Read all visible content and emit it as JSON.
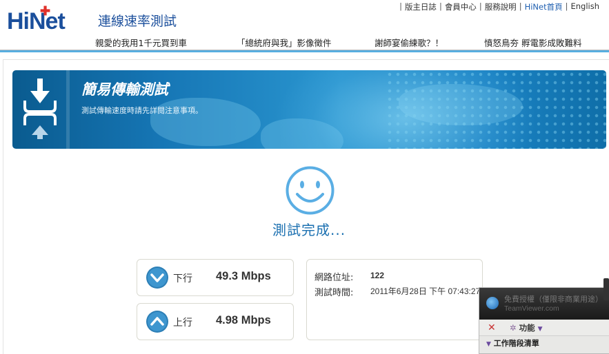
{
  "header": {
    "logo": "HiNet",
    "site_title": "連線速率測試",
    "top_links": [
      "版主日誌",
      "會員中心",
      "服務說明",
      "HiNet首頁",
      "English"
    ],
    "news": [
      "親愛的我用1千元買到車",
      "「總統府與我」影像徵件",
      "謝師宴偷練歌？！",
      "憤怒鳥夯 孵電影成敗難料"
    ]
  },
  "banner": {
    "title": "簡易傳輸測試",
    "subtitle": "測試傳輸速度時請先詳閱注意事項。"
  },
  "status": {
    "icon": "smiley-icon",
    "text": "測試完成..."
  },
  "results": {
    "download_label": "下行",
    "download_value": "49.3 Mbps",
    "upload_label": "上行",
    "upload_value": "4.98 Mbps"
  },
  "info": {
    "ip_label": "網路位址:",
    "ip_value": "122",
    "time_label": "測試時間:",
    "time_value": "2011年6月28日 下午 07:43:27"
  },
  "teamviewer": {
    "line1": "免費授權（僅限非商業用途）",
    "line2": "TeamViewer.com",
    "function_label": "功能",
    "session_label": "工作階段清單"
  },
  "colors": {
    "brand_blue": "#1b4f9c",
    "accent_blue": "#1a6fb0",
    "header_bar": "#58aee0"
  }
}
